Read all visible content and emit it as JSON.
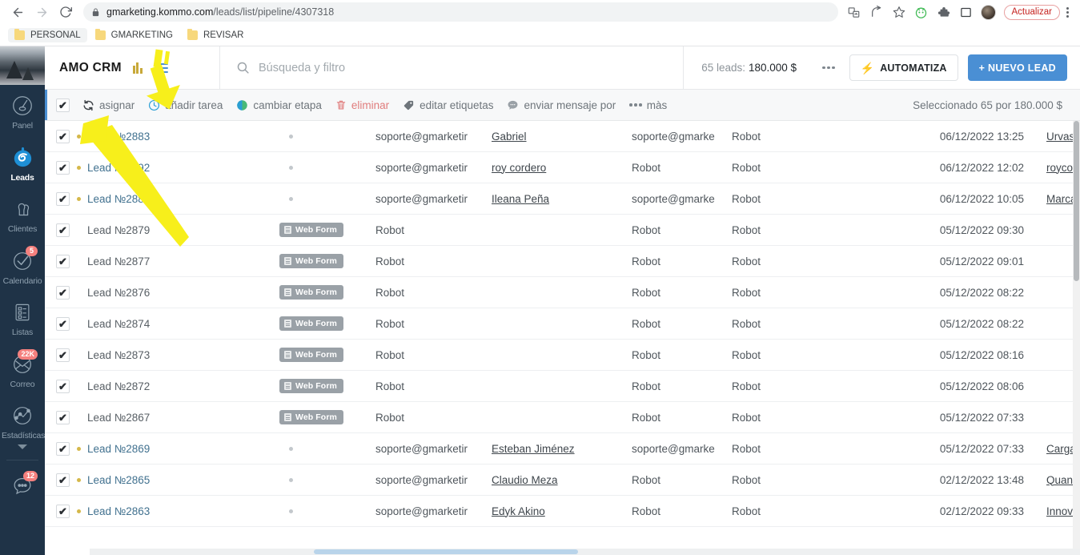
{
  "browser": {
    "url_domain": "gmarketing.kommo.com",
    "url_path": "/leads/list/pipeline/4307318",
    "back_icon": "back-arrow-icon",
    "forward_icon": "forward-arrow-icon",
    "reload_icon": "reload-icon",
    "lock_icon": "lock-icon",
    "update_label": "Actualizar",
    "toolbar_icons": [
      "translate-icon",
      "share-icon",
      "bookmark-star-icon",
      "extension-green-icon",
      "extensions-puzzle-icon",
      "sidepanel-icon",
      "profile-avatar"
    ],
    "bookmarks": [
      {
        "label": "PERSONAL"
      },
      {
        "label": "GMARKETING"
      },
      {
        "label": "REVISAR"
      }
    ]
  },
  "sidebar": {
    "items": [
      {
        "label": "Panel",
        "icon": "gauge-icon",
        "badge": "",
        "active": false
      },
      {
        "label": "Leads",
        "icon": "kommo-leads-icon",
        "badge": "",
        "active": true
      },
      {
        "label": "Clientes",
        "icon": "users-icon",
        "badge": "",
        "active": false
      },
      {
        "label": "Calendario",
        "icon": "check-circle-icon",
        "badge": "5",
        "active": false
      },
      {
        "label": "Listas",
        "icon": "list-icon",
        "badge": "",
        "active": false
      },
      {
        "label": "Correo",
        "icon": "mail-icon",
        "badge": "22K",
        "active": false
      },
      {
        "label": "Estadísticas",
        "icon": "analytics-icon",
        "badge": "",
        "active": false
      }
    ],
    "chat_badge": "12",
    "chat_icon": "chat-bubble-icon"
  },
  "header": {
    "logo": "AMO CRM",
    "pipeline_icon": "pipeline-bars-icon",
    "menu_icon": "hamburger-menu-icon",
    "search_icon": "search-icon",
    "search_placeholder": "Búsqueda y filtro",
    "search_value": "",
    "stats_label": "65 leads:",
    "stats_amount": "180.000 $",
    "more_icon": "more-dots-icon",
    "automate_label": "AUTOMATIZA",
    "automate_icon": "lightning-bolt-icon",
    "new_lead_label": "+ NUEVO LEAD"
  },
  "bulk_bar": {
    "select_all_checked": true,
    "actions": [
      {
        "label": "asignar",
        "icon": "assign-refresh-icon"
      },
      {
        "label": "añadir tarea",
        "icon": "clock-icon"
      },
      {
        "label": "cambiar etapa",
        "icon": "stage-circle-icon"
      },
      {
        "label": "eliminar",
        "icon": "trash-icon"
      },
      {
        "label": "editar etiquetas",
        "icon": "tag-icon"
      },
      {
        "label": "enviar mensaje por",
        "icon": "message-icon"
      },
      {
        "label": "màs",
        "icon": "more-dots-icon"
      }
    ],
    "selection_summary": "Seleccionado 65 por 180.000 $"
  },
  "table": {
    "rows": [
      {
        "checked": true,
        "dot": "yellow",
        "name": "Lead №2883",
        "name_link": true,
        "tag": "",
        "col_dot": true,
        "responsible": "soporte@gmarketir",
        "contact": "Gabriel",
        "responsible2": "soporte@gmarke",
        "robot": "Robot",
        "date": "06/12/2022 13:25",
        "company": "Urvas"
      },
      {
        "checked": true,
        "dot": "yellow",
        "name": "Lead №2892",
        "name_link": true,
        "tag": "",
        "col_dot": true,
        "responsible": "soporte@gmarketir",
        "contact": "roy cordero",
        "responsible2": "Robot",
        "robot": "Robot",
        "date": "06/12/2022 12:02",
        "company": "roycor"
      },
      {
        "checked": true,
        "dot": "yellow",
        "name": "Lead №2889",
        "name_link": true,
        "tag": "",
        "col_dot": true,
        "responsible": "soporte@gmarketir",
        "contact": "Ileana Peña",
        "responsible2": "soporte@gmarke",
        "robot": "Robot",
        "date": "06/12/2022 10:05",
        "company": "Marca"
      },
      {
        "checked": true,
        "dot": "",
        "name": "Lead №2879",
        "name_link": false,
        "tag": "Web Form",
        "col_dot": false,
        "responsible": "Robot",
        "contact": "",
        "responsible2": "Robot",
        "robot": "Robot",
        "date": "05/12/2022 09:30",
        "company": ""
      },
      {
        "checked": true,
        "dot": "",
        "name": "Lead №2877",
        "name_link": false,
        "tag": "Web Form",
        "col_dot": false,
        "responsible": "Robot",
        "contact": "",
        "responsible2": "Robot",
        "robot": "Robot",
        "date": "05/12/2022 09:01",
        "company": ""
      },
      {
        "checked": true,
        "dot": "",
        "name": "Lead №2876",
        "name_link": false,
        "tag": "Web Form",
        "col_dot": false,
        "responsible": "Robot",
        "contact": "",
        "responsible2": "Robot",
        "robot": "Robot",
        "date": "05/12/2022 08:22",
        "company": ""
      },
      {
        "checked": true,
        "dot": "",
        "name": "Lead №2874",
        "name_link": false,
        "tag": "Web Form",
        "col_dot": false,
        "responsible": "Robot",
        "contact": "",
        "responsible2": "Robot",
        "robot": "Robot",
        "date": "05/12/2022 08:22",
        "company": ""
      },
      {
        "checked": true,
        "dot": "",
        "name": "Lead №2873",
        "name_link": false,
        "tag": "Web Form",
        "col_dot": false,
        "responsible": "Robot",
        "contact": "",
        "responsible2": "Robot",
        "robot": "Robot",
        "date": "05/12/2022 08:16",
        "company": ""
      },
      {
        "checked": true,
        "dot": "",
        "name": "Lead №2872",
        "name_link": false,
        "tag": "Web Form",
        "col_dot": false,
        "responsible": "Robot",
        "contact": "",
        "responsible2": "Robot",
        "robot": "Robot",
        "date": "05/12/2022 08:06",
        "company": ""
      },
      {
        "checked": true,
        "dot": "",
        "name": "Lead №2867",
        "name_link": false,
        "tag": "Web Form",
        "col_dot": false,
        "responsible": "Robot",
        "contact": "",
        "responsible2": "Robot",
        "robot": "Robot",
        "date": "05/12/2022 07:33",
        "company": ""
      },
      {
        "checked": true,
        "dot": "yellow",
        "name": "Lead №2869",
        "name_link": true,
        "tag": "",
        "col_dot": true,
        "responsible": "soporte@gmarketir",
        "contact": "Esteban Jiménez",
        "responsible2": "soporte@gmarke",
        "robot": "Robot",
        "date": "05/12/2022 07:33",
        "company": "Carga"
      },
      {
        "checked": true,
        "dot": "yellow",
        "name": "Lead №2865",
        "name_link": true,
        "tag": "",
        "col_dot": true,
        "responsible": "soporte@gmarketir",
        "contact": "Claudio Meza",
        "responsible2": "Robot",
        "robot": "Robot",
        "date": "02/12/2022 13:48",
        "company": "Quant"
      },
      {
        "checked": true,
        "dot": "yellow",
        "name": "Lead №2863",
        "name_link": true,
        "tag": "",
        "col_dot": true,
        "responsible": "soporte@gmarketir",
        "contact": "Edyk Akino",
        "responsible2": "Robot",
        "robot": "Robot",
        "date": "02/12/2022 09:33",
        "company": "Innov"
      }
    ]
  },
  "annotation": {
    "color": "#f7ef1b",
    "shape": "arrow-pointing-to-asignar"
  }
}
